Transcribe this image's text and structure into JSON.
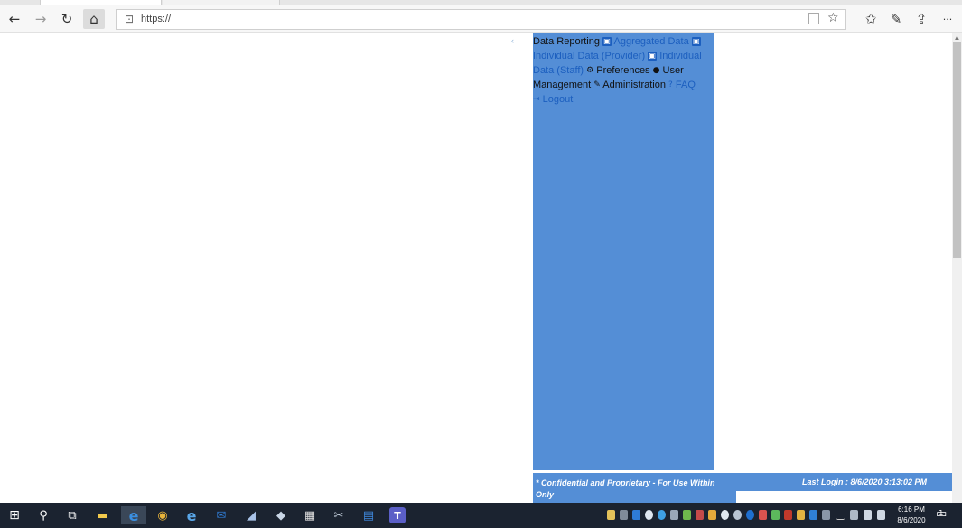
{
  "browser": {
    "url": "https://",
    "toolbar_icons": [
      "back-icon",
      "forward-icon",
      "refresh-icon",
      "home-icon",
      "lock-icon",
      "reading-view-icon",
      "favorite-star-icon",
      "favorites-list-icon",
      "pen-icon",
      "share-icon",
      "more-icon"
    ],
    "glyphs": {
      "back": "←",
      "forward": "→",
      "refresh": "↻",
      "home": "⌂",
      "lock": "🔒",
      "star": "☆",
      "favorites": "✩",
      "pen": "✎",
      "share": "⇪",
      "more": "···"
    }
  },
  "nav": {
    "faint_marker": "‹",
    "items": [
      {
        "label": "Data Reporting",
        "icon": "chart-icon"
      },
      {
        "label": "Aggregated Data",
        "icon": "grid-icon",
        "link": true
      },
      {
        "label": "Individual Data (Provider)",
        "icon": "grid-icon",
        "link": true
      },
      {
        "label": "Individual Data (Staff)",
        "icon": "grid-icon",
        "link": true
      },
      {
        "label": "Preferences",
        "icon": "gears-icon"
      },
      {
        "label": "User Management",
        "icon": "user-icon"
      },
      {
        "label": "Administration",
        "icon": "wrench-icon"
      },
      {
        "label": "FAQ",
        "icon": "question-icon",
        "link": true
      },
      {
        "label": "Logout",
        "icon": "sign-out-icon",
        "link": true
      }
    ],
    "text": {
      "data_reporting": "Data Reporting",
      "aggregated_data": "Aggregated Data",
      "individual_provider_1": "Individual Data (Provider)",
      "individual_staff_1": "Individual",
      "individual_staff_2": "Data (Staff)",
      "preferences": "Preferences",
      "user_1": "User",
      "user_2": "Management",
      "administration": "Administration",
      "faq": "FAQ",
      "logout": "Logout"
    },
    "icon_glyphs": {
      "grid": "▣",
      "gears": "⚙",
      "user": "👤",
      "wrench": "🔧",
      "question": "?",
      "signout": "⇥"
    }
  },
  "footer": {
    "confidential_1": "* Confidential and Proprietary - For Use Within",
    "confidential_2": "Only",
    "last_login": "Last Login : 8/6/2020 3:13:02 PM"
  },
  "taskbar": {
    "icons": [
      "windows-start-icon",
      "search-icon",
      "task-view-icon",
      "file-explorer-icon",
      "edge-icon",
      "chrome-icon",
      "internet-explorer-icon",
      "outlook-icon",
      "onenote-icon",
      "paint-icon",
      "calculator-icon",
      "snipping-tool-icon",
      "outlook-calendar-icon",
      "teams-icon"
    ],
    "glyphs": {
      "start": "⊞",
      "search": "⚲",
      "taskview": "⧉",
      "explorer": "▬",
      "edge": "e",
      "chrome": "◉",
      "ie": "e",
      "outlook": "✉",
      "onenote": "◢",
      "paint": "◆",
      "calc": "▦",
      "snip": "✂",
      "calendar": "▤",
      "teams": "T",
      "notification": "▭"
    },
    "time": "6:16 PM",
    "date": "8/6/2020",
    "notifications": "1"
  },
  "colors": {
    "panel_blue": "#548ed6",
    "link_blue": "#1c5fbf",
    "taskbar": "#1b2330"
  }
}
